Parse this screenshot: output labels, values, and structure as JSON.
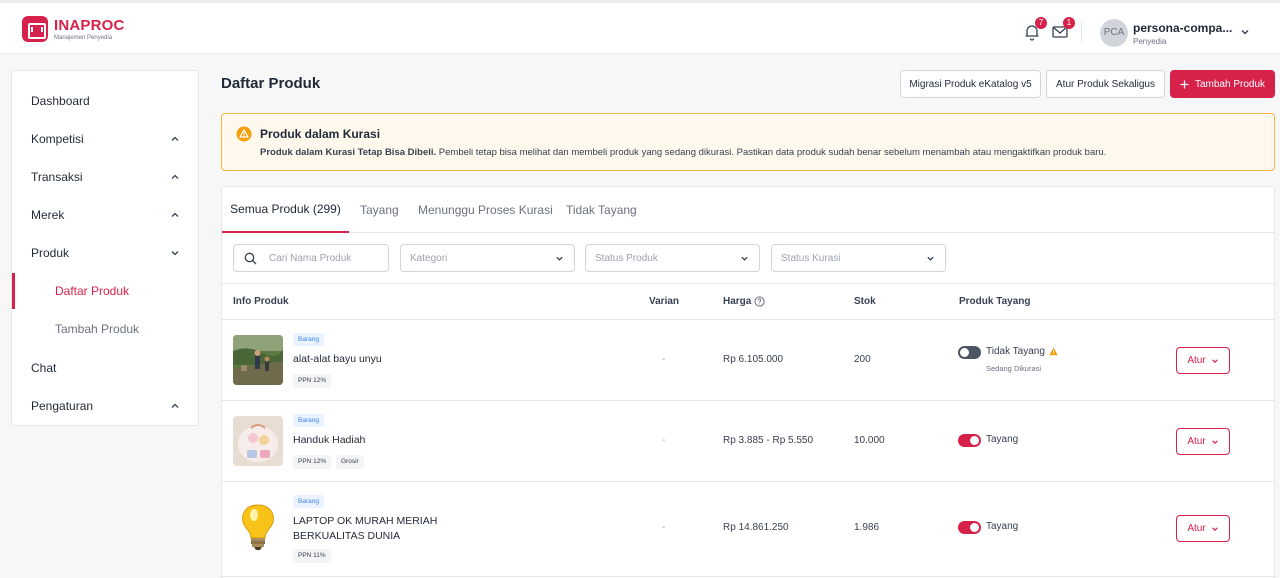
{
  "brand": {
    "title": "INAPROC",
    "subtitle": "Manajemen Penyedia",
    "accent": "#d6224a"
  },
  "header": {
    "notifications_count": "7",
    "messages_count": "1",
    "avatar_initials": "PCA",
    "user_name": "persona-compa...",
    "user_role": "Penyedia"
  },
  "sidebar": {
    "items": [
      {
        "label": "Dashboard"
      },
      {
        "label": "Kompetisi"
      },
      {
        "label": "Transaksi"
      },
      {
        "label": "Merek"
      },
      {
        "label": "Produk"
      },
      {
        "label": "Daftar Produk"
      },
      {
        "label": "Tambah Produk"
      },
      {
        "label": "Chat"
      },
      {
        "label": "Pengaturan"
      }
    ]
  },
  "page": {
    "title": "Daftar Produk",
    "btn_migrasi": "Migrasi Produk eKatalog v5",
    "btn_atur_sekaligus": "Atur Produk Sekaligus",
    "btn_tambah": "Tambah Produk"
  },
  "alert": {
    "title": "Produk dalam Kurasi",
    "body_bold": "Produk dalam Kurasi Tetap Bisa Dibeli.",
    "body_text": " Pembeli tetap bisa melihat dan membeli produk yang sedang dikurasi. Pastikan data produk sudah benar sebelum menambah atau mengaktifkan produk baru."
  },
  "tabs": [
    {
      "label": "Semua Produk (299)"
    },
    {
      "label": "Tayang"
    },
    {
      "label": "Menunggu Proses Kurasi"
    },
    {
      "label": "Tidak Tayang"
    }
  ],
  "filters": {
    "search_placeholder": "Cari Nama Produk",
    "kategori": "Kategori",
    "status_produk": "Status Produk",
    "status_kurasi": "Status Kurasi"
  },
  "table": {
    "headers": {
      "info": "Info Produk",
      "varian": "Varian",
      "harga": "Harga",
      "stok": "Stok",
      "tayang": "Produk Tayang"
    },
    "rows": [
      {
        "type": "Barang",
        "name": "alat-alat bayu unyu",
        "tag1": "PPN 12%",
        "tag2": "",
        "varian": "-",
        "harga": "Rp 6.105.000",
        "stok": "200",
        "status": "Tidak Tayang",
        "status_on": false,
        "sub_status": "Sedang Dikurasi",
        "action": "Atur"
      },
      {
        "type": "Barang",
        "name": "Handuk Hadiah",
        "tag1": "PPN 12%",
        "tag2": "Grosir",
        "varian": "-",
        "harga": "Rp 3.885 - Rp 5.550",
        "stok": "10.000",
        "status": "Tayang",
        "status_on": true,
        "sub_status": "",
        "action": "Atur"
      },
      {
        "type": "Barang",
        "name_line1": "LAPTOP OK MURAH MERIAH",
        "name_line2": "BERKUALITAS DUNIA",
        "tag1": "PPN 11%",
        "tag2": "",
        "varian": "-",
        "harga": "Rp 14.861.250",
        "stok": "1.986",
        "status": "Tayang",
        "status_on": true,
        "sub_status": "",
        "action": "Atur"
      }
    ]
  }
}
